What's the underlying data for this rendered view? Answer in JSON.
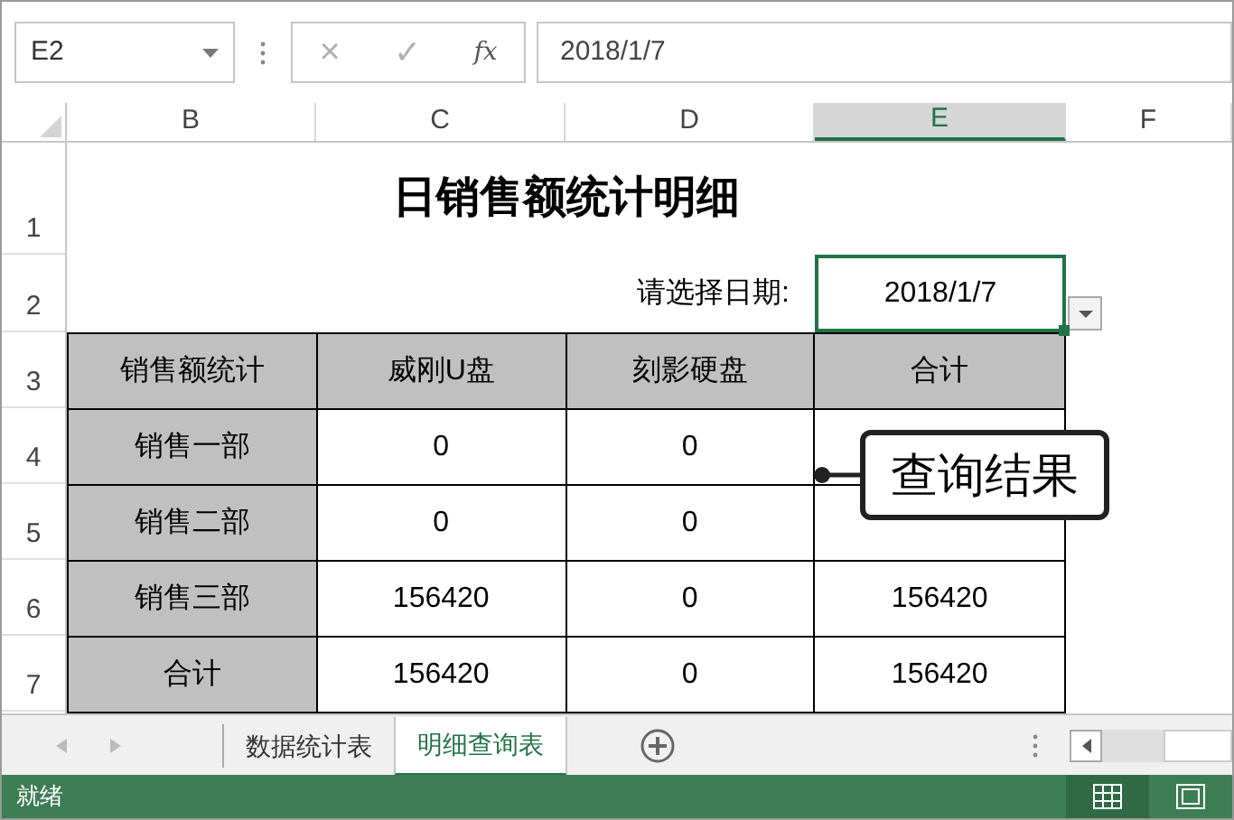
{
  "name_box": "E2",
  "formula_bar": {
    "cancel": "×",
    "enter": "✓",
    "fx": "fx",
    "value": "2018/1/7"
  },
  "column_headers": [
    {
      "label": "B",
      "selected": false
    },
    {
      "label": "C",
      "selected": false
    },
    {
      "label": "D",
      "selected": false
    },
    {
      "label": "E",
      "selected": true
    },
    {
      "label": "F",
      "selected": false
    }
  ],
  "row_numbers": [
    "1",
    "2",
    "3",
    "4",
    "5",
    "6",
    "7"
  ],
  "title": "日销售额统计明细",
  "date_label": "请选择日期:",
  "date_value": "2018/1/7",
  "table": {
    "header": [
      "销售额统计",
      "威刚U盘",
      "刻影硬盘",
      "合计"
    ],
    "rows": [
      {
        "label": "销售一部",
        "cells": [
          "0",
          "0"
        ]
      },
      {
        "label": "销售二部",
        "cells": [
          "0",
          "0"
        ]
      },
      {
        "label": "销售三部",
        "cells": [
          "156420",
          "0",
          "156420"
        ]
      },
      {
        "label": "合计",
        "cells": [
          "156420",
          "0",
          "156420"
        ]
      }
    ]
  },
  "callout": "查询结果",
  "sheet_tabs": [
    {
      "label": "数据统计表",
      "selected": false
    },
    {
      "label": "明细查询表",
      "selected": true
    }
  ],
  "status": "就绪"
}
